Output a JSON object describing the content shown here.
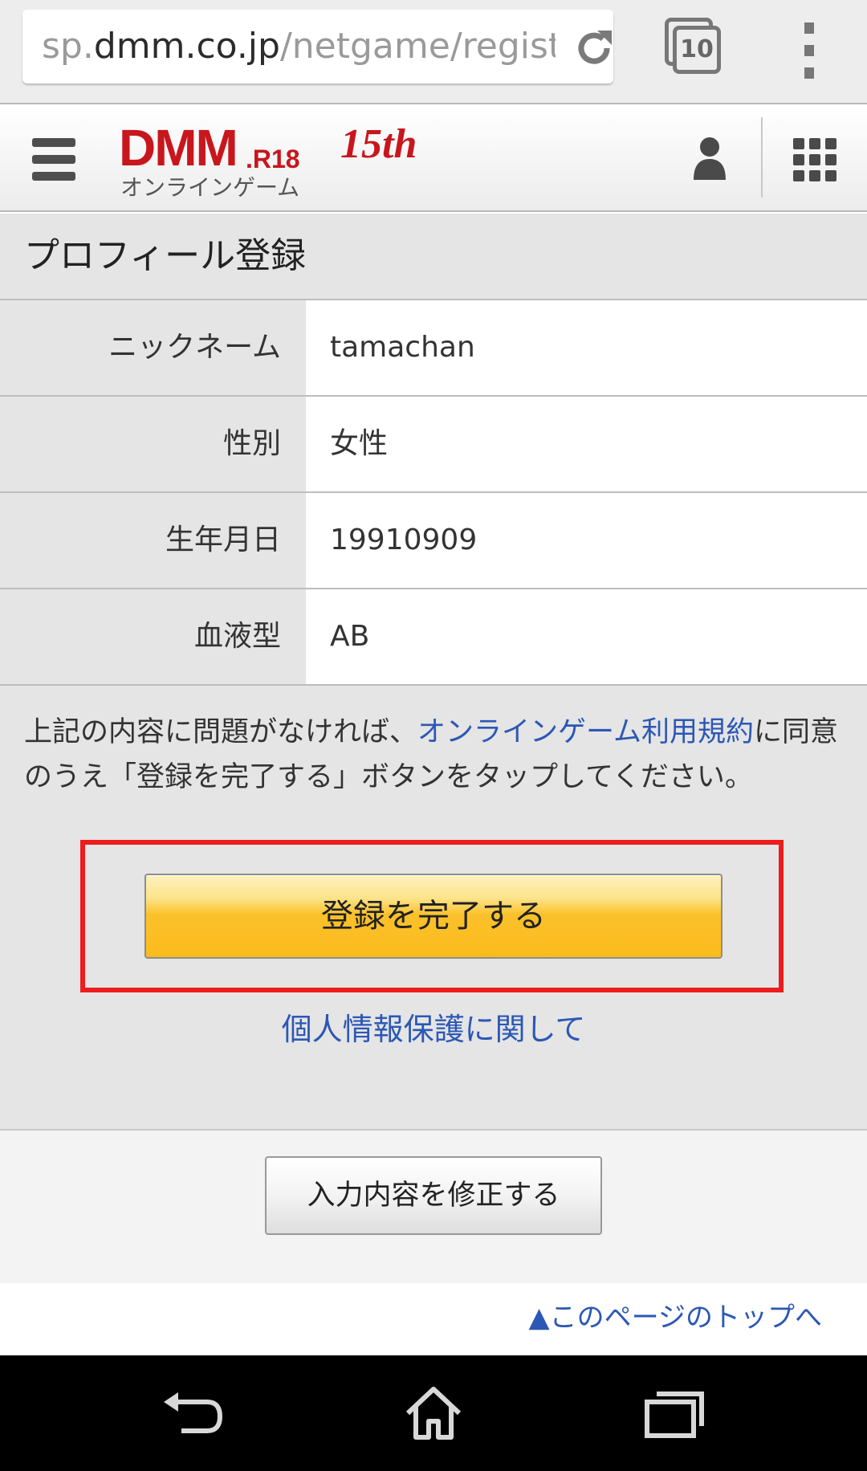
{
  "browser": {
    "url_prefix": "sp.",
    "url_domain": "dmm.co.jp",
    "url_path": "/netgame/regist/",
    "tab_count": "10"
  },
  "header": {
    "logo_dmm": "DMM",
    "logo_r18": ".R18",
    "logo_anniversary": "15th",
    "logo_subtitle": "オンラインゲーム"
  },
  "page": {
    "title": "プロフィール登録"
  },
  "profile": [
    {
      "label": "ニックネーム",
      "value": "tamachan"
    },
    {
      "label": "性別",
      "value": "女性"
    },
    {
      "label": "生年月日",
      "value": "19910909"
    },
    {
      "label": "血液型",
      "value": "AB"
    }
  ],
  "notice": {
    "before_link": "上記の内容に問題がなければ、",
    "link_text": "オンラインゲーム利用規約",
    "after_link": "に同意のうえ「登録を完了する」ボタンをタップしてください。"
  },
  "buttons": {
    "complete_label": "登録を完了する",
    "edit_label": "入力内容を修正する"
  },
  "links": {
    "privacy": "個人情報保護に関して",
    "page_top": "▲このページのトップへ"
  },
  "colors": {
    "brand_red": "#c8161d",
    "link_blue": "#2c58b5",
    "button_yellow": "#fbbb1c",
    "highlight_red": "#ee1c1c"
  },
  "icons": {
    "reload": "reload-icon",
    "tabs": "tabs-icon",
    "overflow_menu": "more-vert-icon",
    "hamburger": "hamburger-menu-icon",
    "user": "user-icon",
    "apps": "grid-icon",
    "nav_back": "back-icon",
    "nav_home": "home-icon",
    "nav_recents": "recents-icon"
  }
}
